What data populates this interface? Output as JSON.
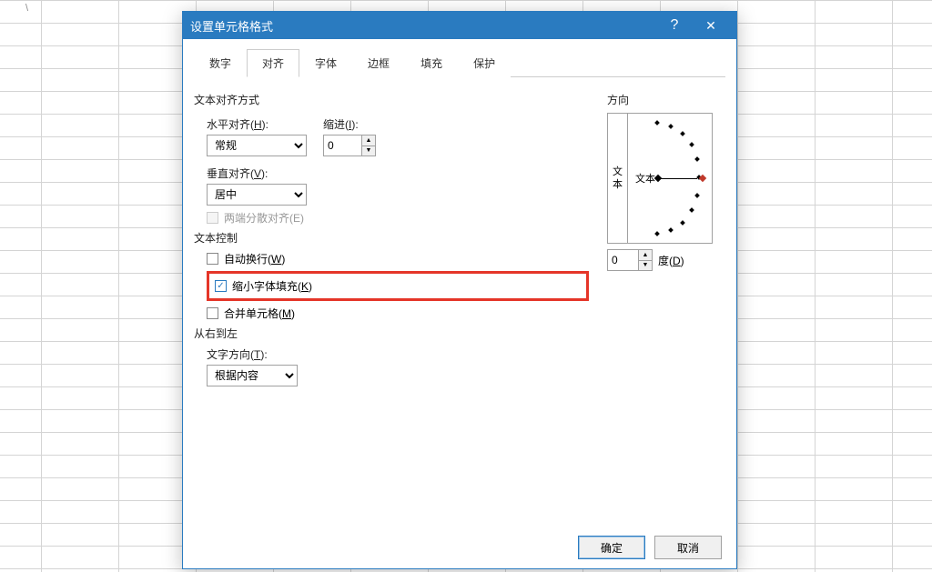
{
  "cell_ref": "\\",
  "dialog": {
    "title": "设置单元格格式",
    "tabs": [
      "数字",
      "对齐",
      "字体",
      "边框",
      "填充",
      "保护"
    ],
    "active_tab_index": 1,
    "sections": {
      "text_align": {
        "label": "文本对齐方式",
        "horizontal_label": "水平对齐(H):",
        "horizontal_value": "常规",
        "indent_label": "缩进(I):",
        "indent_value": "0",
        "vertical_label": "垂直对齐(V):",
        "vertical_value": "居中",
        "justify_distributed_label": "两端分散对齐(E)"
      },
      "text_control": {
        "label": "文本控制",
        "wrap_label": "自动换行(W)",
        "shrink_label": "缩小字体填充(K)",
        "merge_label": "合并单元格(M)"
      },
      "rtl": {
        "label": "从右到左",
        "dir_label": "文字方向(T):",
        "dir_value": "根据内容"
      },
      "orientation": {
        "label": "方向",
        "vert_text": [
          "文",
          "本"
        ],
        "dial_text": "文本",
        "degree_value": "0",
        "degree_label": "度(D)"
      }
    },
    "buttons": {
      "ok": "确定",
      "cancel": "取消"
    }
  }
}
